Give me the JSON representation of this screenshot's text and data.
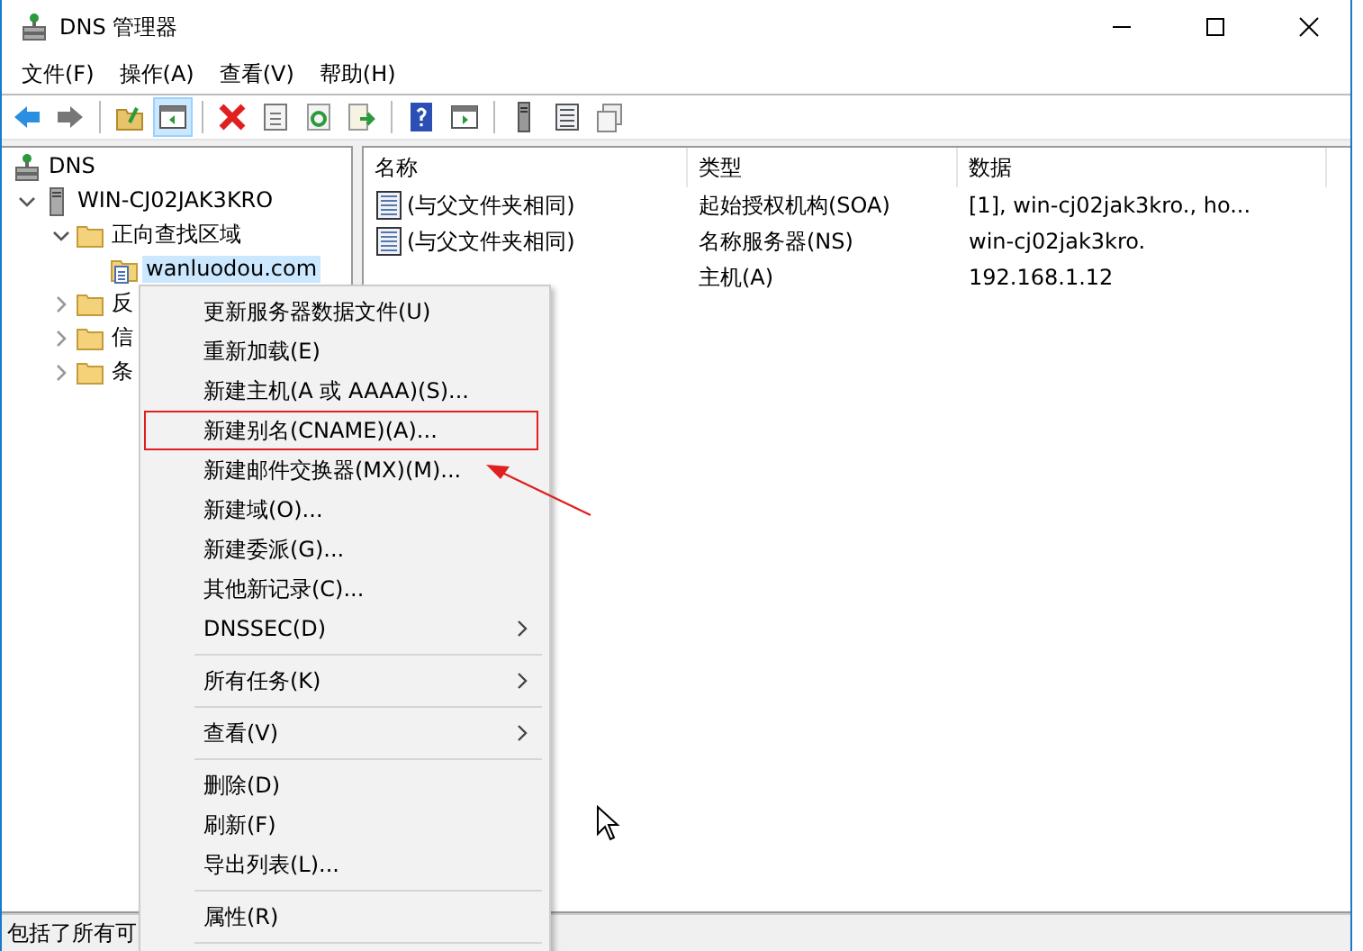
{
  "window": {
    "title": "DNS 管理器"
  },
  "menu_bar": [
    "文件(F)",
    "操作(A)",
    "查看(V)",
    "帮助(H)"
  ],
  "toolbar": [
    {
      "kind": "back",
      "pressed": false
    },
    {
      "kind": "forward",
      "pressed": false
    },
    {
      "kind": "sep"
    },
    {
      "kind": "folder-up",
      "pressed": false
    },
    {
      "kind": "tree-toggle",
      "pressed": true
    },
    {
      "kind": "sep"
    },
    {
      "kind": "delete",
      "pressed": false
    },
    {
      "kind": "properties",
      "pressed": false
    },
    {
      "kind": "refresh",
      "pressed": false
    },
    {
      "kind": "export",
      "pressed": false
    },
    {
      "kind": "sep"
    },
    {
      "kind": "help",
      "pressed": false
    },
    {
      "kind": "panel",
      "pressed": false
    },
    {
      "kind": "sep"
    },
    {
      "kind": "server",
      "pressed": false
    },
    {
      "kind": "list",
      "pressed": false
    },
    {
      "kind": "copy",
      "pressed": false
    }
  ],
  "tree": [
    {
      "label": "DNS",
      "kind": "dns",
      "selected": false,
      "children": [
        {
          "label": "WIN-CJ02JAK3KRO",
          "kind": "server",
          "expanded": true,
          "selected": false,
          "children": [
            {
              "label": "正向查找区域",
              "kind": "folder",
              "expanded": true,
              "selected": false,
              "children": [
                {
                  "label": "wanluodou.com",
                  "kind": "zone",
                  "selected": true
                }
              ]
            },
            {
              "label": "反",
              "kind": "folder",
              "expanded": false,
              "selected": false
            },
            {
              "label": "信",
              "kind": "folder",
              "expanded": false,
              "selected": false
            },
            {
              "label": "条",
              "kind": "folder",
              "expanded": false,
              "selected": false
            }
          ]
        }
      ]
    }
  ],
  "table": {
    "columns": [
      "名称",
      "类型",
      "数据"
    ],
    "rows": [
      {
        "name": "(与父文件夹相同)",
        "type": "起始授权机构(SOA)",
        "data": "[1], win-cj02jak3kro., ho..."
      },
      {
        "name": "(与父文件夹相同)",
        "type": "名称服务器(NS)",
        "data": "win-cj02jak3kro."
      },
      {
        "type": "主机(A)",
        "data": "192.168.1.12"
      }
    ]
  },
  "context_menu": {
    "groups": [
      [
        {
          "label": "更新服务器数据文件(U)",
          "kind": "item",
          "highlighted": false
        },
        {
          "label": "重新加载(E)",
          "kind": "item",
          "highlighted": false
        },
        {
          "label": "新建主机(A 或 AAAA)(S)...",
          "kind": "item",
          "highlighted": false
        },
        {
          "label": "新建别名(CNAME)(A)...",
          "kind": "item",
          "highlighted": true
        },
        {
          "label": "新建邮件交换器(MX)(M)...",
          "kind": "item",
          "highlighted": false
        },
        {
          "label": "新建域(O)...",
          "kind": "item",
          "highlighted": false
        },
        {
          "label": "新建委派(G)...",
          "kind": "item",
          "highlighted": false
        },
        {
          "label": "其他新记录(C)...",
          "kind": "item",
          "highlighted": false
        },
        {
          "label": "DNSSEC(D)",
          "kind": "submenu",
          "highlighted": false
        }
      ],
      [
        {
          "label": "所有任务(K)",
          "kind": "submenu",
          "highlighted": false
        }
      ],
      [
        {
          "label": "查看(V)",
          "kind": "submenu",
          "highlighted": false
        }
      ],
      [
        {
          "label": "删除(D)",
          "kind": "item",
          "highlighted": false
        },
        {
          "label": "刷新(F)",
          "kind": "item",
          "highlighted": false
        },
        {
          "label": "导出列表(L)...",
          "kind": "item",
          "highlighted": false
        }
      ],
      [
        {
          "label": "属性(R)",
          "kind": "item",
          "highlighted": false
        }
      ]
    ]
  },
  "status_bar": "包括了所有可"
}
